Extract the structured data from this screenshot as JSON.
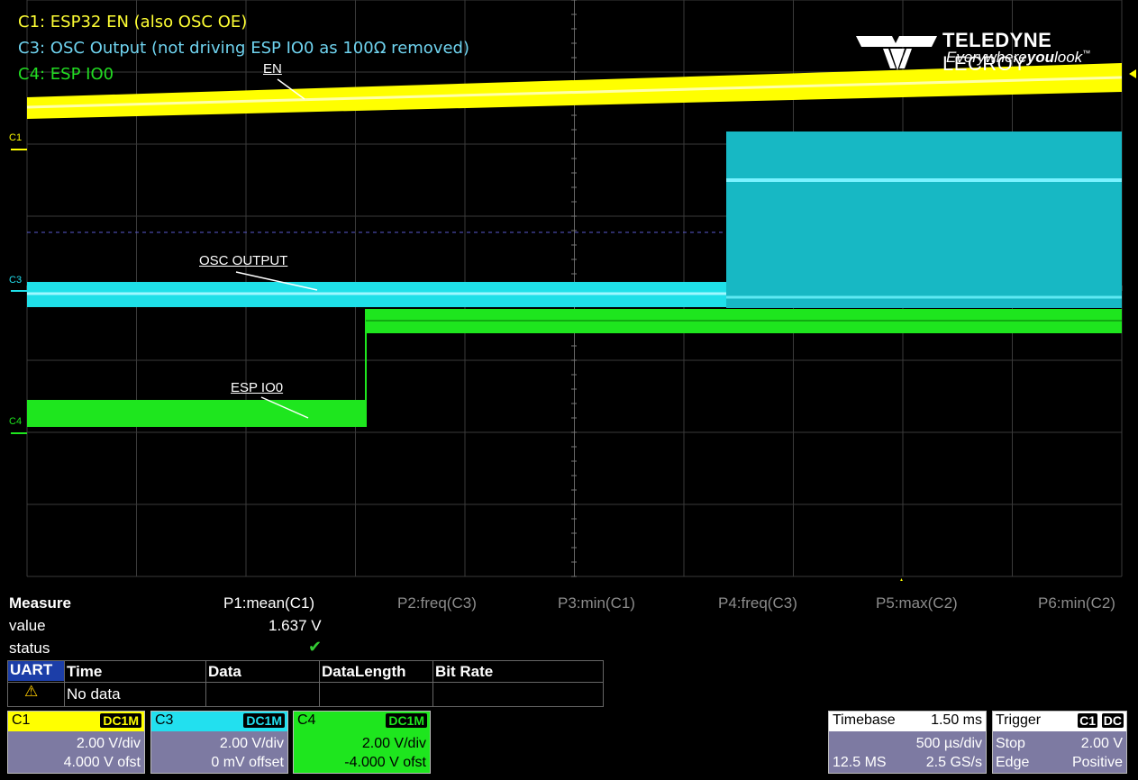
{
  "annotations": [
    {
      "text": "C1: ESP32 EN (also OSC OE)",
      "color": "#ffff33"
    },
    {
      "text": "C3: OSC Output (not driving ESP IO0 as 100Ω removed)",
      "color": "#6fd3ef"
    },
    {
      "text": "C4: ESP IO0",
      "color": "#22dd22"
    }
  ],
  "brand": {
    "name_bold": "TELEDYNE",
    "name_light": "LECROY",
    "tag_a": "Everywhere",
    "tag_b": "you",
    "tag_c": "look",
    "tm": "™"
  },
  "trace_labels": {
    "en": "EN",
    "osc": "OSC OUTPUT",
    "io0": "ESP IO0"
  },
  "channel_markers": {
    "c1": "C1",
    "c3": "C3",
    "c4": "C4"
  },
  "colors": {
    "c1": "#ffff00",
    "c3": "#1fe0e8",
    "c4": "#1ee61e",
    "grid": "#3a3a3a"
  },
  "measure": {
    "title": "Measure",
    "row_value": "value",
    "row_status": "status",
    "params": [
      "P1:mean(C1)",
      "P2:freq(C3)",
      "P3:min(C1)",
      "P4:freq(C3)",
      "P5:max(C2)",
      "P6:min(C2)"
    ],
    "p1_value": "1.637 V",
    "p1_status": "✔"
  },
  "uart": {
    "tag": "UART",
    "columns": [
      "Time",
      "Data",
      "DataLength",
      "Bit Rate"
    ],
    "row_text": "No data",
    "warning": "⚠"
  },
  "channels": [
    {
      "name": "C1",
      "coupling": "DC1M",
      "vdiv": "2.00 V/div",
      "offset": "4.000 V ofst",
      "color": "#ffff00"
    },
    {
      "name": "C3",
      "coupling": "DC1M",
      "vdiv": "2.00 V/div",
      "offset": "0 mV offset",
      "color": "#22e0ef"
    },
    {
      "name": "C4",
      "coupling": "DC1M",
      "vdiv": "2.00 V/div",
      "offset": "-4.000 V ofst",
      "color": "#1ee61e"
    }
  ],
  "timebase": {
    "label": "Timebase",
    "delay": "1.50 ms",
    "tdiv": "500 µs/div",
    "samples": "12.5 MS",
    "rate": "2.5 GS/s"
  },
  "trigger": {
    "label": "Trigger",
    "src": "C1",
    "coupling": "DC",
    "mode": "Stop",
    "level": "2.00 V",
    "type": "Edge",
    "slope": "Positive"
  }
}
